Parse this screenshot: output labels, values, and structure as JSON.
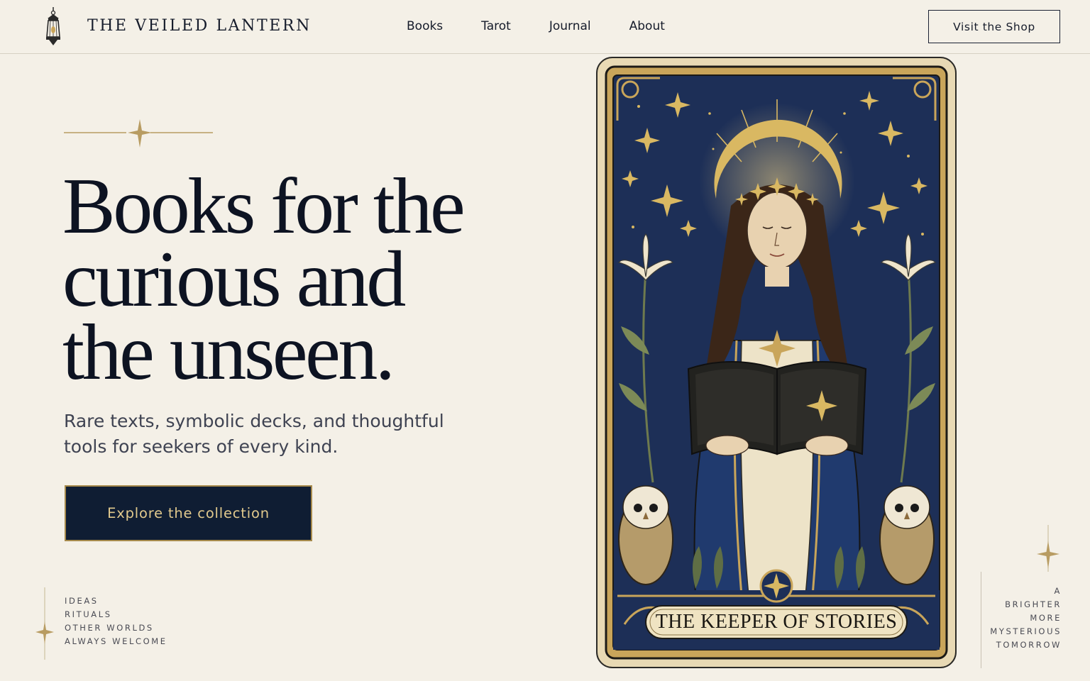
{
  "header": {
    "brand": "THE VEILED LANTERN",
    "nav": [
      "Books",
      "Tarot",
      "Journal",
      "About"
    ],
    "shop_label": "Visit the Shop"
  },
  "hero": {
    "headline_lines": [
      "Books for the",
      "curious and",
      "the unseen."
    ],
    "subtitle_lines": [
      "Rare texts, symbolic decks, and thoughtful",
      "tools for seekers of every kind."
    ],
    "cta_label": "Explore the collection"
  },
  "left_tags": [
    "IDEAS",
    "RITUALS",
    "OTHER WORLDS",
    "ALWAYS WELCOME"
  ],
  "right_tags": [
    "A",
    "BRIGHTER",
    "MORE",
    "MYSTERIOUS",
    "TOMORROW"
  ],
  "card": {
    "title": "THE KEEPER OF STORIES"
  },
  "colors": {
    "background": "#f4f0e7",
    "ink": "#0d1322",
    "navy": "#0f1d33",
    "gold": "#c9a55a",
    "card_night": "#1d2f57"
  },
  "icons": {
    "logo": "lantern-icon",
    "ornament": "four-point-star-icon"
  }
}
